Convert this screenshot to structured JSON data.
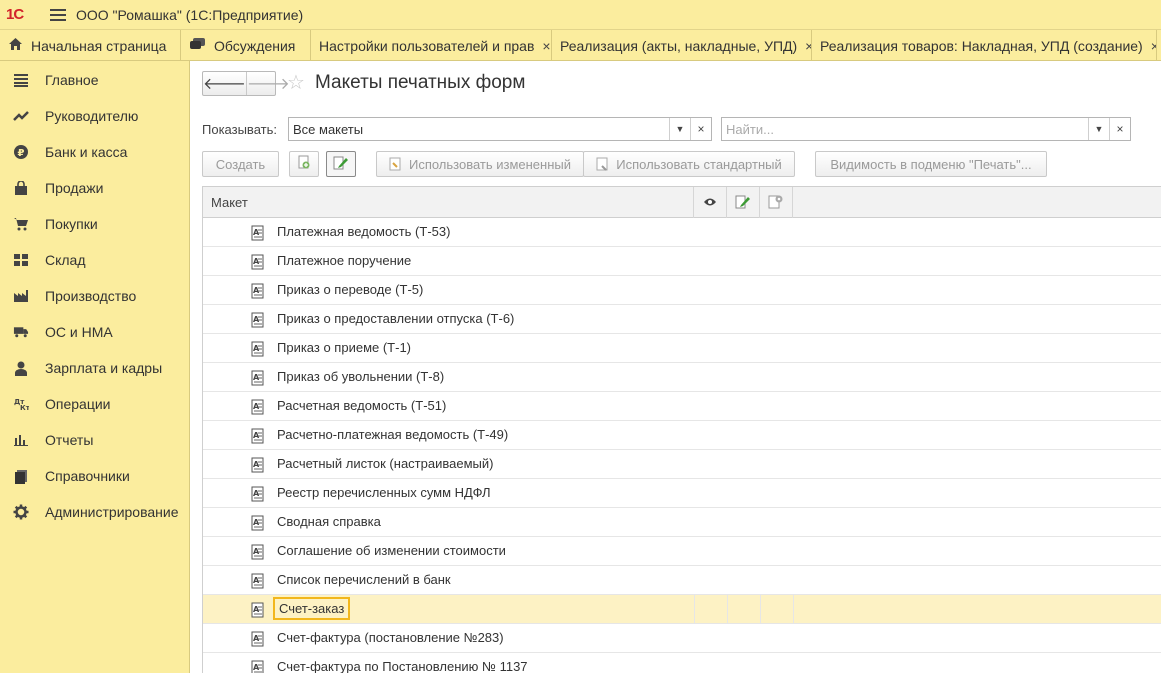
{
  "app": {
    "logo": "1С",
    "title": "ООО \"Ромашка\"  (1С:Предприятие)"
  },
  "tabs": [
    {
      "label": "Начальная страница",
      "icon": "home-icon"
    },
    {
      "label": "Обсуждения",
      "icon": "chat-icon"
    },
    {
      "label": "Настройки пользователей и прав",
      "closable": true
    },
    {
      "label": "Реализация (акты, накладные, УПД)",
      "closable": true
    },
    {
      "label": "Реализация товаров: Накладная, УПД (создание)",
      "closable": true
    }
  ],
  "close_glyph": "×",
  "sidebar": {
    "items": [
      {
        "label": "Главное",
        "icon": "list-icon"
      },
      {
        "label": "Руководителю",
        "icon": "trend-icon"
      },
      {
        "label": "Банк и касса",
        "icon": "ruble-icon"
      },
      {
        "label": "Продажи",
        "icon": "bag-icon"
      },
      {
        "label": "Покупки",
        "icon": "cart-icon"
      },
      {
        "label": "Склад",
        "icon": "warehouse-icon"
      },
      {
        "label": "Производство",
        "icon": "factory-icon"
      },
      {
        "label": "ОС и НМА",
        "icon": "truck-icon"
      },
      {
        "label": "Зарплата и кадры",
        "icon": "person-icon"
      },
      {
        "label": "Операции",
        "icon": "dt-kt-icon"
      },
      {
        "label": "Отчеты",
        "icon": "bar-chart-icon"
      },
      {
        "label": "Справочники",
        "icon": "books-icon"
      },
      {
        "label": "Администрирование",
        "icon": "gear-icon"
      }
    ]
  },
  "page": {
    "title": "Макеты печатных форм",
    "show_label": "Показывать:",
    "show_value": "Все макеты",
    "search_placeholder": "Найти..."
  },
  "toolbar": {
    "create": "Создать",
    "use_modified": "Использовать измененный",
    "use_standard": "Использовать стандартный",
    "visibility": "Видимость в подменю \"Печать\"..."
  },
  "table": {
    "header": "Макет",
    "rows": [
      {
        "name": "Платежная ведомость (Т-53)"
      },
      {
        "name": "Платежное поручение"
      },
      {
        "name": "Приказ о переводе (Т-5)"
      },
      {
        "name": "Приказ о предоставлении отпуска (Т-6)"
      },
      {
        "name": "Приказ о приеме (Т-1)"
      },
      {
        "name": "Приказ об увольнении (Т-8)"
      },
      {
        "name": "Расчетная ведомость (Т-51)"
      },
      {
        "name": "Расчетно-платежная ведомость (Т-49)"
      },
      {
        "name": "Расчетный листок (настраиваемый)"
      },
      {
        "name": "Реестр перечисленных сумм НДФЛ"
      },
      {
        "name": "Сводная справка"
      },
      {
        "name": "Соглашение об изменении стоимости"
      },
      {
        "name": "Список перечислений в банк"
      },
      {
        "name": "Счет-заказ",
        "selected": true
      },
      {
        "name": "Счет-фактура (постановление №283)"
      },
      {
        "name": "Счет-фактура по Постановлению № 1137"
      }
    ]
  },
  "colors": {
    "panel": "#fbed9e",
    "selection": "#fdf2c4",
    "selection_border": "#f2b71d",
    "logo_red": "#d2232a"
  }
}
